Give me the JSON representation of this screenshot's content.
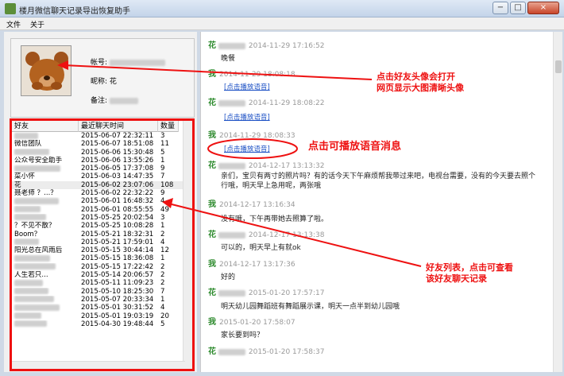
{
  "window": {
    "title": "楼月微信聊天记录导出恢复助手",
    "minimize": "−",
    "maximize": "□",
    "close": "×"
  },
  "menu": {
    "file": "文件",
    "about": "关于"
  },
  "profile": {
    "account_label": "帐号:",
    "nickname_label": "昵称:",
    "nickname_value": "花",
    "remark_label": "备注:"
  },
  "friend_list": {
    "headers": [
      "好友",
      "最近聊天时间",
      "数量"
    ],
    "rows": [
      [
        "",
        "2015-06-07 22:32:11",
        "3"
      ],
      [
        "微信团队",
        "2015-06-07 18:51:08",
        "11"
      ],
      [
        "",
        "2015-06-06 15:30:48",
        "5"
      ],
      [
        "公众号安全助手",
        "2015-06-06 13:55:26",
        "1"
      ],
      [
        "",
        "2015-06-05 17:37:08",
        "9"
      ],
      [
        "菜小怀",
        "2015-06-03 14:47:35",
        "7"
      ],
      [
        "花",
        "2015-06-02 23:07:06",
        "108"
      ],
      [
        "聂老师 ？...？",
        "2015-06-02 22:32:22",
        "9"
      ],
      [
        "",
        "2015-06-01 16:48:32",
        "4"
      ],
      [
        "",
        "2015-06-01 08:55:55",
        "49"
      ],
      [
        "",
        "2015-05-25 20:02:54",
        "3"
      ],
      [
        "？不见不散？",
        "2015-05-25 10:08:28",
        "1"
      ],
      [
        "Boom？",
        "2015-05-21 18:32:31",
        "2"
      ],
      [
        "",
        "2015-05-21 17:59:01",
        "4"
      ],
      [
        "阳光总在风雨后",
        "2015-05-15 30:44:14",
        "12"
      ],
      [
        "",
        "2015-05-15 18:36:08",
        "1"
      ],
      [
        "",
        "2015-05-15 17:22:42",
        "2"
      ],
      [
        "人生若只...",
        "2015-05-14 20:06:57",
        "2"
      ],
      [
        "",
        "2015-05-11 11:09:23",
        "2"
      ],
      [
        "",
        "2015-05-10 18:25:30",
        "7"
      ],
      [
        "",
        "2015-05-07 20:33:34",
        "1"
      ],
      [
        "",
        "2015-05-01 30:31:52",
        "4"
      ],
      [
        "",
        "2015-05-01 19:03:19",
        "20"
      ],
      [
        "",
        "2015-04-30 19:48:44",
        "5"
      ]
    ]
  },
  "chat": {
    "messages": [
      {
        "sender": "花",
        "time": "2014-11-29 17:16:52",
        "text": "晚餐",
        "voice": ""
      },
      {
        "sender": "我",
        "time": "2014-11-29 18:08:18",
        "text": "",
        "voice": "[点击播放语音]"
      },
      {
        "sender": "花",
        "time": "2014-11-29 18:08:22",
        "text": "",
        "voice": "[点击播放语音]"
      },
      {
        "sender": "我",
        "time": "2014-11-29 18:08:33",
        "text": "",
        "voice": "[点击播放语音]"
      },
      {
        "sender": "花",
        "time": "2014-12-17 13:13:32",
        "text": "亲们，宝贝有两寸的照片吗？有的话今天下午麻烦帮我带过来吧，电视台需要，没有的今天要去照个行哦，明天早上急用呢，两张哦",
        "voice": ""
      },
      {
        "sender": "我",
        "time": "2014-12-17 13:16:34",
        "text": "没有哦，下午再带她去照算了啦。",
        "voice": ""
      },
      {
        "sender": "花",
        "time": "2014-12-17 13:13:38",
        "text": "可以的，明天早上有就ok",
        "voice": ""
      },
      {
        "sender": "我",
        "time": "2014-12-17 13:17:36",
        "text": "好的",
        "voice": ""
      },
      {
        "sender": "花",
        "time": "2015-01-20 17:57:17",
        "text": "明天幼儿园舞蹈班有舞蹈展示课，明天一点半到幼儿园哦",
        "voice": ""
      },
      {
        "sender": "我",
        "time": "2015-01-20 17:58:07",
        "text": "家长要到吗？",
        "voice": ""
      },
      {
        "sender": "花",
        "time": "2015-01-20 17:58:37",
        "text": "",
        "voice": ""
      }
    ]
  },
  "annotations": {
    "avatar_note": "点击好友头像会打开\n网页显示大图清晰头像",
    "voice_note": "点击可播放语音消息",
    "list_note": "好友列表，点击可查看\n该好友聊天记录"
  },
  "colors": {
    "annotation": "#ee1111",
    "sender": "#2e8b2e",
    "link": "#1a4fc4"
  }
}
